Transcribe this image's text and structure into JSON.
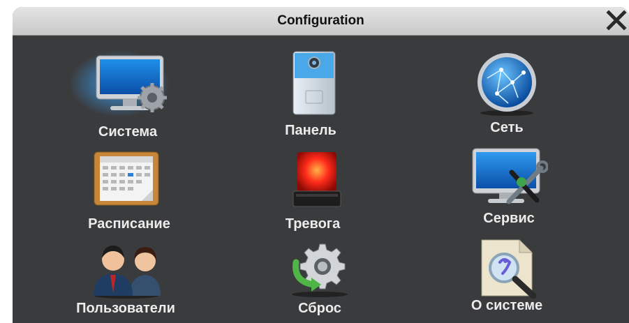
{
  "window": {
    "title": "Configuration"
  },
  "icons": {
    "close": "close-icon"
  },
  "menu": [
    {
      "label": "Система",
      "icon": "system-monitor-icon"
    },
    {
      "label": "Панель",
      "icon": "door-panel-icon"
    },
    {
      "label": "Сеть",
      "icon": "network-globe-icon"
    },
    {
      "label": "Расписание",
      "icon": "schedule-calendar-icon"
    },
    {
      "label": "Тревога",
      "icon": "alarm-beacon-icon"
    },
    {
      "label": "Сервис",
      "icon": "service-tools-icon"
    },
    {
      "label": "Пользователи",
      "icon": "users-icon"
    },
    {
      "label": "Сброс",
      "icon": "reset-gear-icon"
    },
    {
      "label": "О системе",
      "icon": "about-magnifier-icon"
    }
  ]
}
